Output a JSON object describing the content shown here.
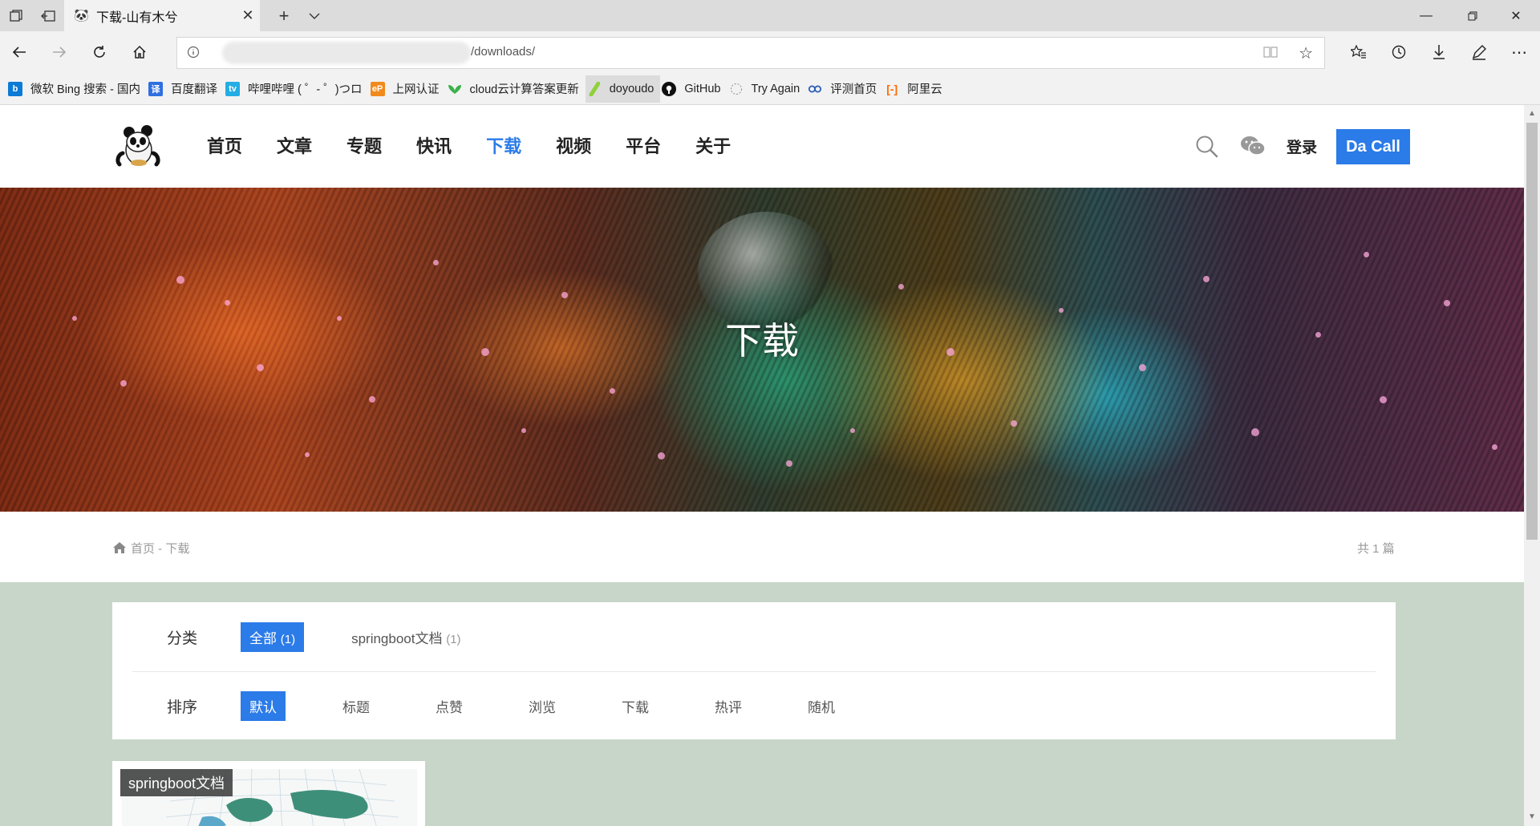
{
  "browser": {
    "tab": {
      "title": "下载-山有木兮"
    },
    "address": {
      "url_path": "/downloads/"
    },
    "bookmarks": [
      {
        "label": "微软 Bing 搜索 - 国内",
        "icon": "bing-icon",
        "color": "#0c7bd6"
      },
      {
        "label": "百度翻译",
        "icon": "baidu-translate-icon",
        "color": "#2f6fe0"
      },
      {
        "label": "哔哩哔哩 ( ゜- ゜)つロ",
        "icon": "bilibili-icon",
        "color": "#23ade5"
      },
      {
        "label": "上网认证",
        "icon": "ep-icon",
        "color": "#f08a1c"
      },
      {
        "label": "cloud云计算答案更新",
        "icon": "leaf-icon",
        "color": "#3bb24a"
      },
      {
        "label": "doyoudo",
        "icon": "doyoudo-icon",
        "color": "#8fd13b"
      },
      {
        "label": "GitHub",
        "icon": "github-icon",
        "color": "#111111"
      },
      {
        "label": "Try Again",
        "icon": "tryagain-icon",
        "color": "#888888"
      },
      {
        "label": "评测首页",
        "icon": "review-icon",
        "color": "#2a5fb8"
      },
      {
        "label": "阿里云",
        "icon": "aliyun-icon",
        "color": "#ff6a00"
      }
    ]
  },
  "site": {
    "nav": [
      "首页",
      "文章",
      "专题",
      "快讯",
      "下载",
      "视频",
      "平台",
      "关于"
    ],
    "nav_active_index": 4,
    "login": "登录",
    "cta": "Da Call",
    "accent": "#2b7be8"
  },
  "banner": {
    "title": "下载"
  },
  "breadcrumb": {
    "text": "首页 - 下载",
    "total": "共 1 篇"
  },
  "filters": {
    "category_label": "分类",
    "categories": [
      {
        "name": "全部",
        "count": "(1)",
        "active": true
      },
      {
        "name": "springboot文档",
        "count": "(1)",
        "active": false
      }
    ],
    "sort_label": "排序",
    "sorts": [
      "默认",
      "标题",
      "点赞",
      "浏览",
      "下载",
      "热评",
      "随机"
    ],
    "sort_active_index": 0
  },
  "cards": [
    {
      "tag": "springboot文档"
    }
  ]
}
